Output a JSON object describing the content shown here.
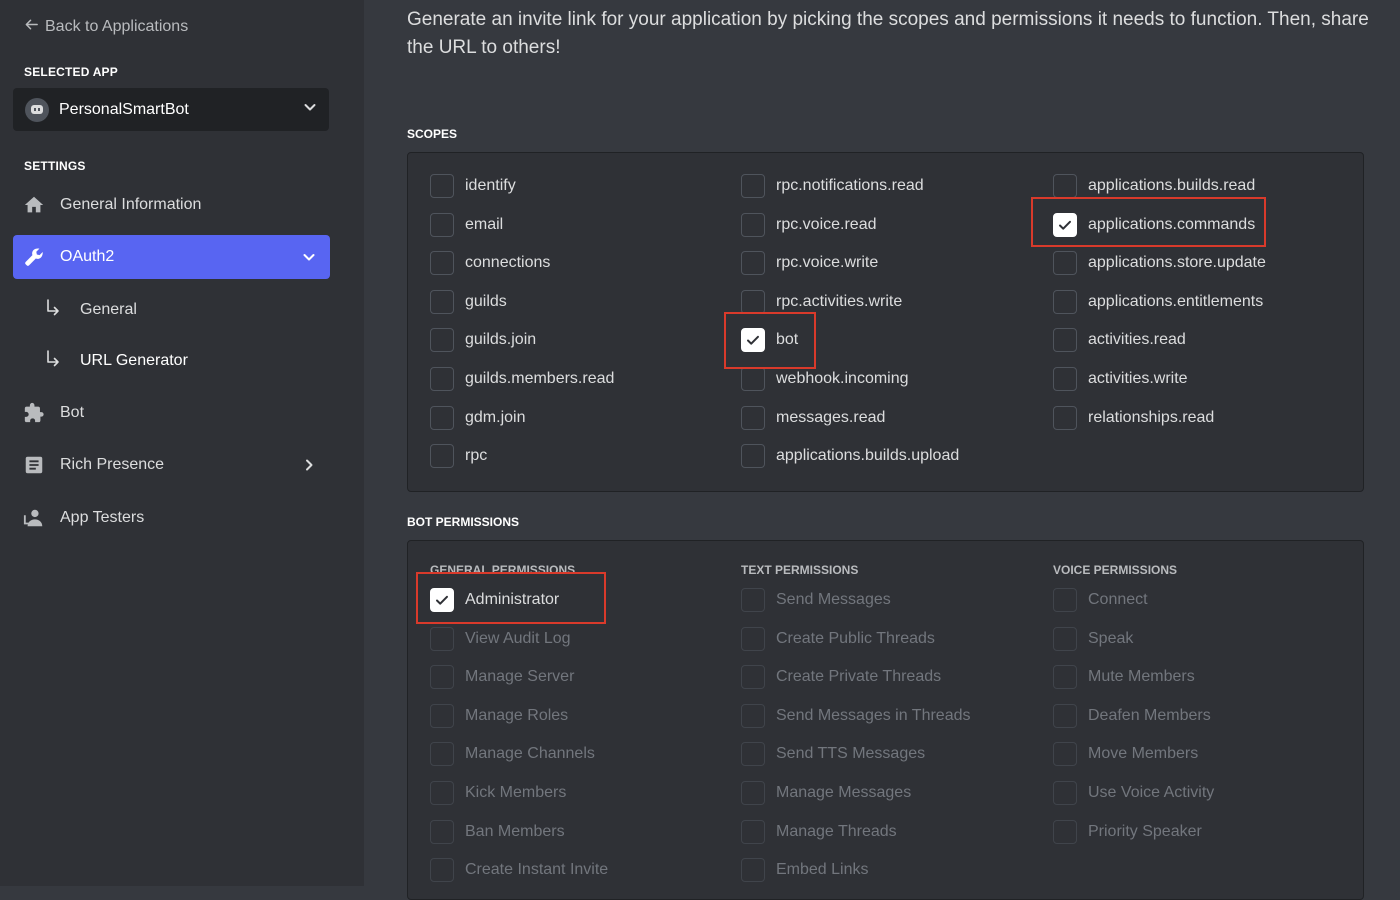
{
  "sidebar": {
    "back_label": "Back to Applications",
    "selected_app_label": "SELECTED APP",
    "app_name": "PersonalSmartBot",
    "settings_label": "SETTINGS",
    "items": [
      {
        "label": "General Information",
        "icon": "home-icon"
      },
      {
        "label": "OAuth2",
        "icon": "wrench-icon",
        "active": true
      },
      {
        "label": "General",
        "icon": "sub-arrow-icon"
      },
      {
        "label": "URL Generator",
        "icon": "sub-arrow-icon"
      },
      {
        "label": "Bot",
        "icon": "puzzle-icon"
      },
      {
        "label": "Rich Presence",
        "icon": "document-icon"
      },
      {
        "label": "App Testers",
        "icon": "person-icon"
      }
    ]
  },
  "main": {
    "intro": "Generate an invite link for your application by picking the scopes and permissions it needs to function. Then, share the URL to others!",
    "scopes_heading": "SCOPES",
    "scopes": [
      [
        {
          "label": "identify",
          "checked": false
        },
        {
          "label": "email",
          "checked": false
        },
        {
          "label": "connections",
          "checked": false
        },
        {
          "label": "guilds",
          "checked": false
        },
        {
          "label": "guilds.join",
          "checked": false
        },
        {
          "label": "guilds.members.read",
          "checked": false
        },
        {
          "label": "gdm.join",
          "checked": false
        },
        {
          "label": "rpc",
          "checked": false
        }
      ],
      [
        {
          "label": "rpc.notifications.read",
          "checked": false
        },
        {
          "label": "rpc.voice.read",
          "checked": false
        },
        {
          "label": "rpc.voice.write",
          "checked": false
        },
        {
          "label": "rpc.activities.write",
          "checked": false
        },
        {
          "label": "bot",
          "checked": true
        },
        {
          "label": "webhook.incoming",
          "checked": false
        },
        {
          "label": "messages.read",
          "checked": false
        },
        {
          "label": "applications.builds.upload",
          "checked": false
        }
      ],
      [
        {
          "label": "applications.builds.read",
          "checked": false
        },
        {
          "label": "applications.commands",
          "checked": true
        },
        {
          "label": "applications.store.update",
          "checked": false
        },
        {
          "label": "applications.entitlements",
          "checked": false
        },
        {
          "label": "activities.read",
          "checked": false
        },
        {
          "label": "activities.write",
          "checked": false
        },
        {
          "label": "relationships.read",
          "checked": false
        }
      ]
    ],
    "bot_permissions_heading": "BOT PERMISSIONS",
    "permission_columns": [
      {
        "heading": "GENERAL PERMISSIONS",
        "items": [
          {
            "label": "Administrator",
            "checked": true,
            "disabled": false
          },
          {
            "label": "View Audit Log",
            "checked": false,
            "disabled": true
          },
          {
            "label": "Manage Server",
            "checked": false,
            "disabled": true
          },
          {
            "label": "Manage Roles",
            "checked": false,
            "disabled": true
          },
          {
            "label": "Manage Channels",
            "checked": false,
            "disabled": true
          },
          {
            "label": "Kick Members",
            "checked": false,
            "disabled": true
          },
          {
            "label": "Ban Members",
            "checked": false,
            "disabled": true
          },
          {
            "label": "Create Instant Invite",
            "checked": false,
            "disabled": true
          }
        ]
      },
      {
        "heading": "TEXT PERMISSIONS",
        "items": [
          {
            "label": "Send Messages",
            "checked": false,
            "disabled": true
          },
          {
            "label": "Create Public Threads",
            "checked": false,
            "disabled": true
          },
          {
            "label": "Create Private Threads",
            "checked": false,
            "disabled": true
          },
          {
            "label": "Send Messages in Threads",
            "checked": false,
            "disabled": true
          },
          {
            "label": "Send TTS Messages",
            "checked": false,
            "disabled": true
          },
          {
            "label": "Manage Messages",
            "checked": false,
            "disabled": true
          },
          {
            "label": "Manage Threads",
            "checked": false,
            "disabled": true
          },
          {
            "label": "Embed Links",
            "checked": false,
            "disabled": true
          }
        ]
      },
      {
        "heading": "VOICE PERMISSIONS",
        "items": [
          {
            "label": "Connect",
            "checked": false,
            "disabled": true
          },
          {
            "label": "Speak",
            "checked": false,
            "disabled": true
          },
          {
            "label": "Mute Members",
            "checked": false,
            "disabled": true
          },
          {
            "label": "Deafen Members",
            "checked": false,
            "disabled": true
          },
          {
            "label": "Move Members",
            "checked": false,
            "disabled": true
          },
          {
            "label": "Use Voice Activity",
            "checked": false,
            "disabled": true
          },
          {
            "label": "Priority Speaker",
            "checked": false,
            "disabled": true
          }
        ]
      }
    ]
  },
  "colors": {
    "background": "#36393f",
    "sidebar": "#2f3136",
    "accent": "#5865f2",
    "highlight_box": "#d93a2b"
  }
}
